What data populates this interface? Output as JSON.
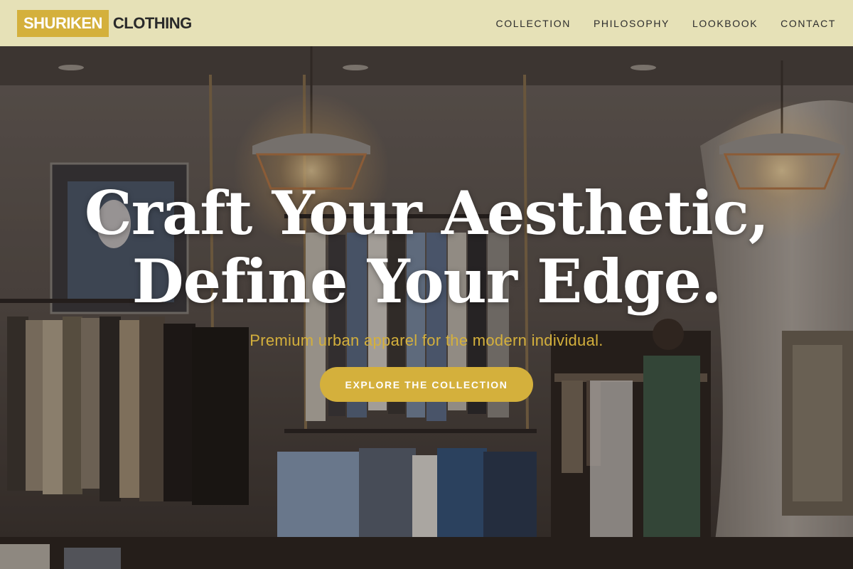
{
  "brand": {
    "highlight": "SHURIKEN",
    "name": "CLOTHING"
  },
  "nav": {
    "items": [
      "COLLECTION",
      "PHILOSOPHY",
      "LOOKBOOK",
      "CONTACT"
    ]
  },
  "hero": {
    "headline_line1": "Craft Your Aesthetic,",
    "headline_line2": "Define Your Edge.",
    "subheading": "Premium urban apparel for the modern individual.",
    "cta_label": "EXPLORE THE COLLECTION"
  },
  "colors": {
    "header_bg": "#e6e1b7",
    "accent": "#d4b03c",
    "headline": "#ffffff"
  }
}
